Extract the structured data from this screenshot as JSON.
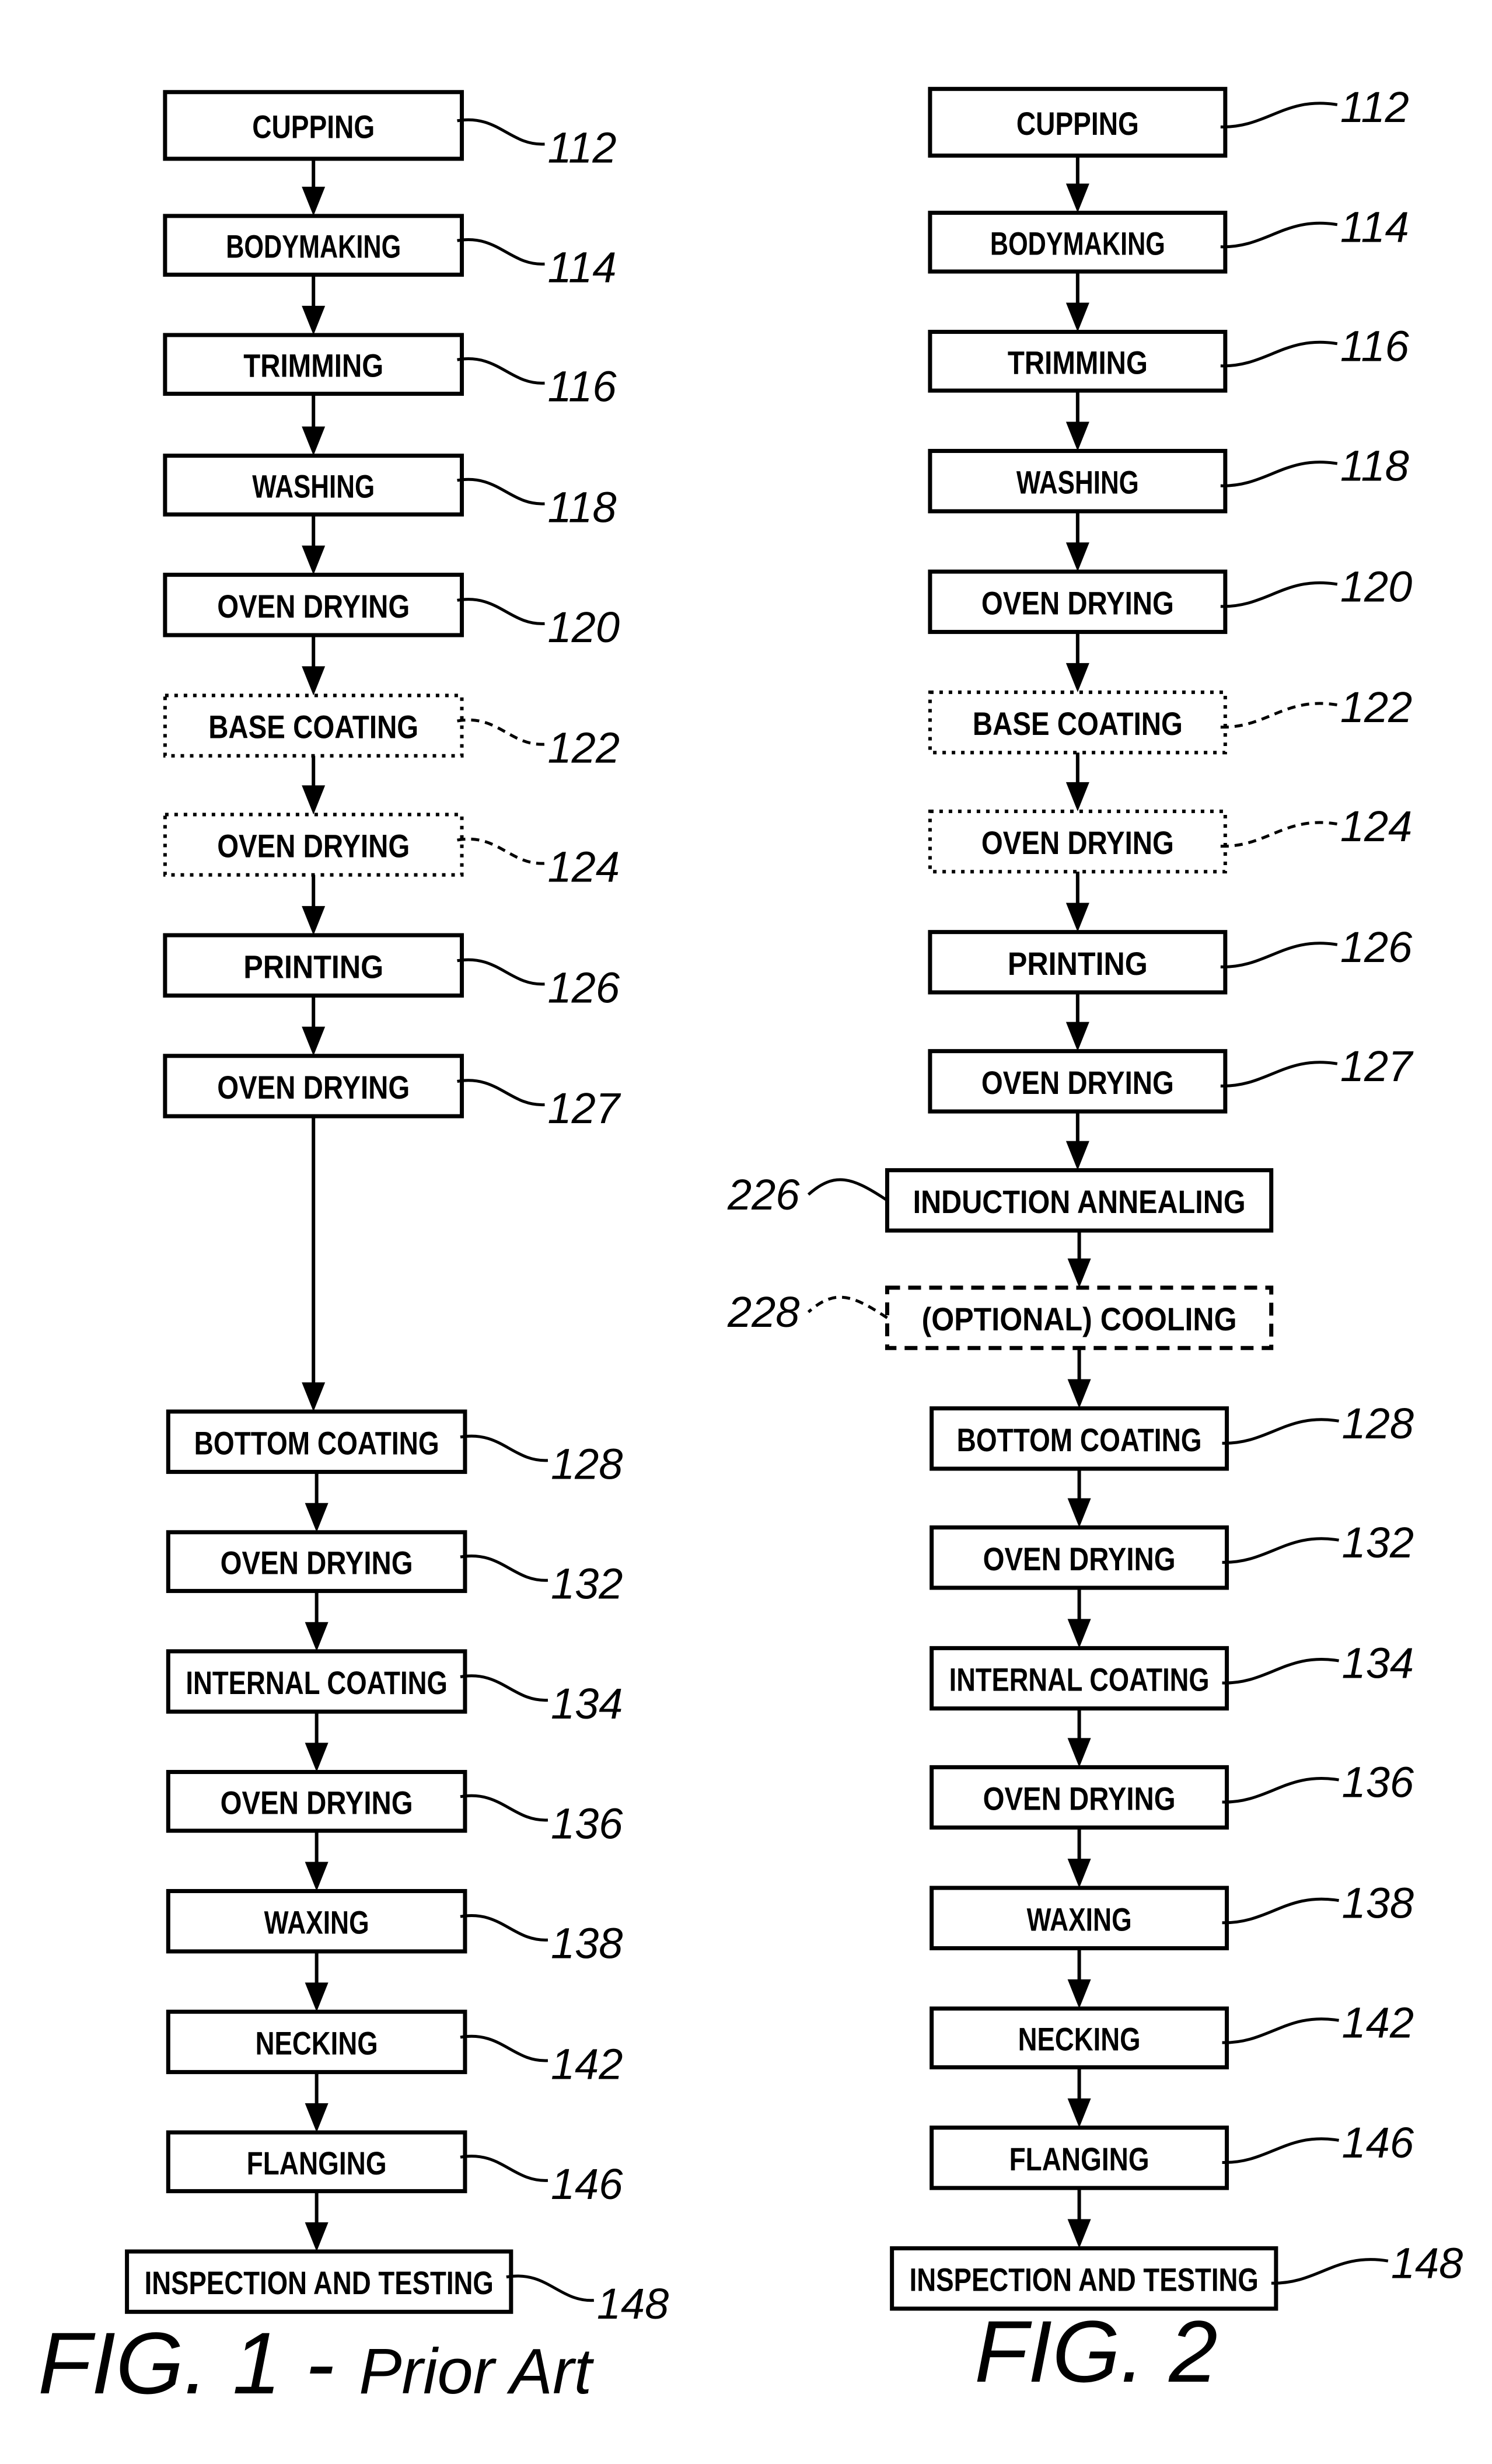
{
  "figures": [
    {
      "caption_main": "FIG. 1 - ",
      "caption_sub": "Prior Art",
      "steps": [
        {
          "label": "CUPPING",
          "ref": "112",
          "style": "solid"
        },
        {
          "label": "BODYMAKING",
          "ref": "114",
          "style": "solid"
        },
        {
          "label": "TRIMMING",
          "ref": "116",
          "style": "solid"
        },
        {
          "label": "WASHING",
          "ref": "118",
          "style": "solid"
        },
        {
          "label": "OVEN DRYING",
          "ref": "120",
          "style": "solid"
        },
        {
          "label": "BASE COATING",
          "ref": "122",
          "style": "dotted"
        },
        {
          "label": "OVEN DRYING",
          "ref": "124",
          "style": "dotted"
        },
        {
          "label": "PRINTING",
          "ref": "126",
          "style": "solid"
        },
        {
          "label": "OVEN DRYING",
          "ref": "127",
          "style": "solid"
        },
        {
          "label": "BOTTOM COATING",
          "ref": "128",
          "style": "solid"
        },
        {
          "label": "OVEN DRYING",
          "ref": "132",
          "style": "solid"
        },
        {
          "label": "INTERNAL COATING",
          "ref": "134",
          "style": "solid"
        },
        {
          "label": "OVEN DRYING",
          "ref": "136",
          "style": "solid"
        },
        {
          "label": "WAXING",
          "ref": "138",
          "style": "solid"
        },
        {
          "label": "NECKING",
          "ref": "142",
          "style": "solid"
        },
        {
          "label": "FLANGING",
          "ref": "146",
          "style": "solid"
        },
        {
          "label": "INSPECTION AND TESTING",
          "ref": "148",
          "style": "solid"
        }
      ]
    },
    {
      "caption_main": "FIG. 2",
      "caption_sub": "",
      "steps": [
        {
          "label": "CUPPING",
          "ref": "112",
          "style": "solid"
        },
        {
          "label": "BODYMAKING",
          "ref": "114",
          "style": "solid"
        },
        {
          "label": "TRIMMING",
          "ref": "116",
          "style": "solid"
        },
        {
          "label": "WASHING",
          "ref": "118",
          "style": "solid"
        },
        {
          "label": "OVEN DRYING",
          "ref": "120",
          "style": "solid"
        },
        {
          "label": "BASE COATING",
          "ref": "122",
          "style": "dotted"
        },
        {
          "label": "OVEN DRYING",
          "ref": "124",
          "style": "dotted"
        },
        {
          "label": "PRINTING",
          "ref": "126",
          "style": "solid"
        },
        {
          "label": "OVEN DRYING",
          "ref": "127",
          "style": "solid"
        },
        {
          "label": "INDUCTION ANNEALING",
          "ref": "226",
          "style": "solid",
          "ref_side": "left"
        },
        {
          "label": "(OPTIONAL) COOLING",
          "ref": "228",
          "style": "dashed",
          "ref_side": "left"
        },
        {
          "label": "BOTTOM COATING",
          "ref": "128",
          "style": "solid"
        },
        {
          "label": "OVEN DRYING",
          "ref": "132",
          "style": "solid"
        },
        {
          "label": "INTERNAL COATING",
          "ref": "134",
          "style": "solid"
        },
        {
          "label": "OVEN DRYING",
          "ref": "136",
          "style": "solid"
        },
        {
          "label": "WAXING",
          "ref": "138",
          "style": "solid"
        },
        {
          "label": "NECKING",
          "ref": "142",
          "style": "solid"
        },
        {
          "label": "FLANGING",
          "ref": "146",
          "style": "solid"
        },
        {
          "label": "INSPECTION AND TESTING",
          "ref": "148",
          "style": "solid"
        }
      ]
    }
  ]
}
